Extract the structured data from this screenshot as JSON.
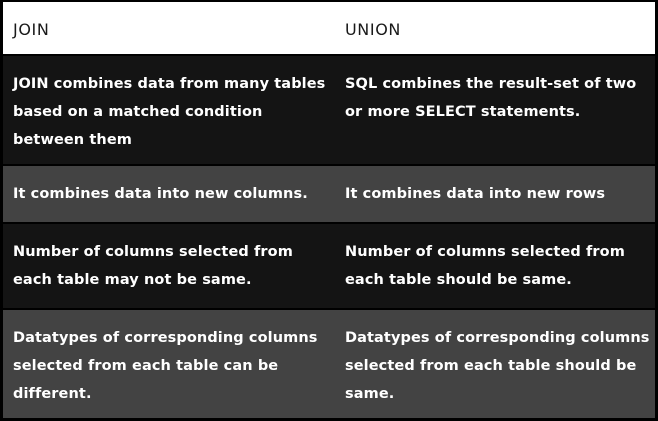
{
  "table": {
    "headers": [
      "JOIN",
      "UNION"
    ],
    "rows": [
      [
        "JOIN combines data from many tables based on a matched condition between them",
        "SQL combines the result-set of two or more SELECT statements."
      ],
      [
        "It combines data into new columns.",
        "It combines data into new rows"
      ],
      [
        "Number of columns selected from each table may not be same.",
        "Number of columns selected from each table should be same."
      ],
      [
        "Datatypes of corresponding columns selected from each table can be different.",
        "Datatypes of corresponding columns selected from each table should be same."
      ]
    ]
  },
  "colors": {
    "header_bg": "#ffffff",
    "row_dark": "#141414",
    "row_mid": "#434343",
    "text_light": "#ffffff",
    "text_dark": "#1a1a1a"
  }
}
